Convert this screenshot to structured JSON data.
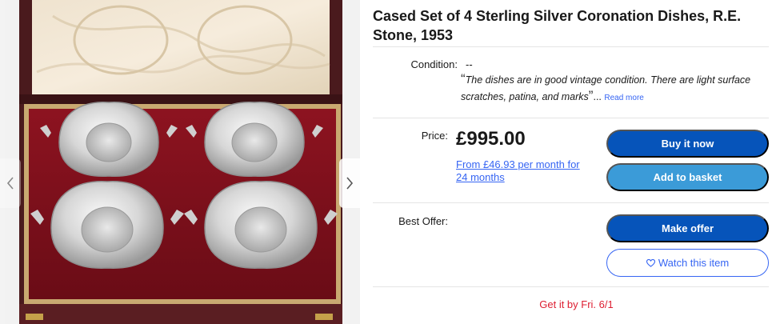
{
  "listing": {
    "title": "Cased Set of 4 Sterling Silver Coronation Dishes, R.E. Stone, 1953"
  },
  "gallery": {
    "image_alt": "Four silver coronation dishes in a red-lined presentation case",
    "prev_icon": "chevron-left-icon",
    "next_icon": "chevron-right-icon"
  },
  "condition": {
    "label": "Condition:",
    "value": "--",
    "open_quote": "“",
    "quote": "The dishes are in good vintage condition. There are light surface scratches, patina, and marks",
    "close_quote": "”",
    "ellipsis": "...",
    "read_more": "Read more"
  },
  "price": {
    "label": "Price:",
    "amount": "£995.00",
    "finance_text": "From £46.93 per month for 24 months"
  },
  "actions": {
    "buy_now": "Buy it now",
    "add_to_basket": "Add to basket",
    "make_offer": "Make offer",
    "watch": "Watch this item",
    "watch_icon": "heart-outline-icon"
  },
  "best_offer": {
    "label": "Best Offer:"
  },
  "delivery": {
    "text": "Get it by Fri. 6/1"
  },
  "colors": {
    "primary_button": "#0654ba",
    "secondary_button": "#3b9bd8",
    "link": "#3665f3",
    "delivery_red": "#dd1e31"
  }
}
